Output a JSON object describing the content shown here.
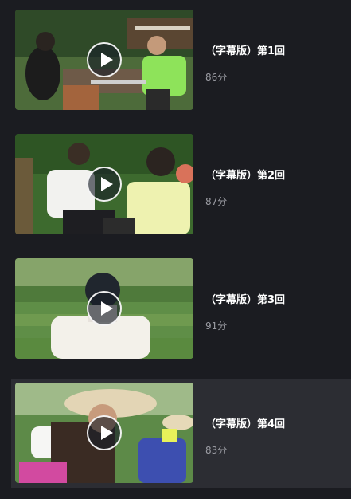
{
  "episodes": [
    {
      "title": "（字幕版）第1回",
      "duration": "86分",
      "selected": false
    },
    {
      "title": "（字幕版）第2回",
      "duration": "87分",
      "selected": false
    },
    {
      "title": "（字幕版）第3回",
      "duration": "91分",
      "selected": false
    },
    {
      "title": "（字幕版）第4回",
      "duration": "83分",
      "selected": true
    }
  ],
  "colors": {
    "background": "#1b1c21",
    "selected_row": "#2c2d33",
    "title_text": "#ffffff",
    "duration_text": "#9a9ba2"
  },
  "icons": {
    "play": "play-icon"
  }
}
